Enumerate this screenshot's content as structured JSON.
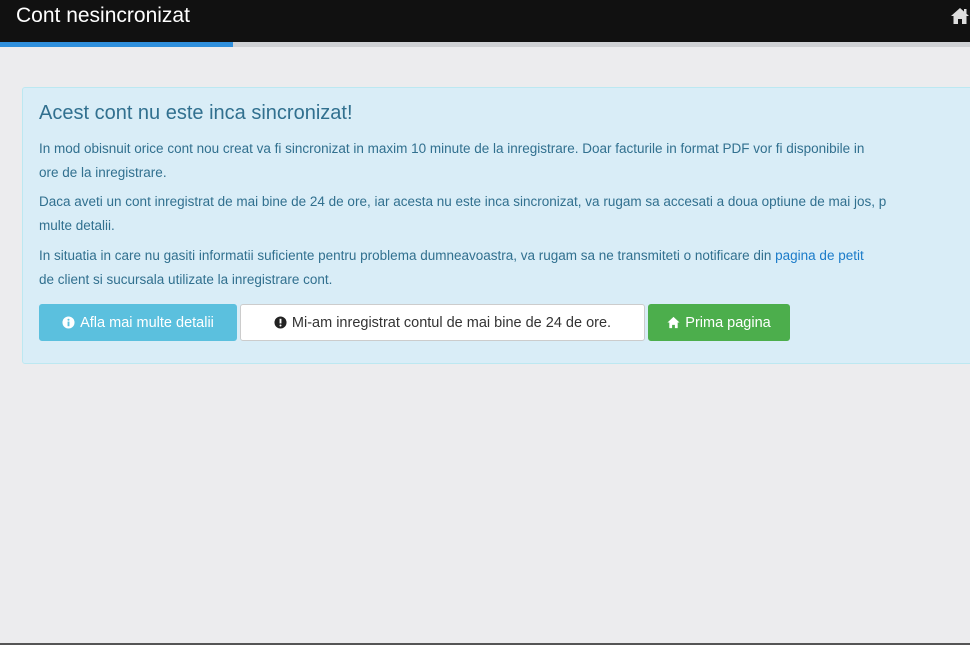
{
  "header": {
    "title": "Cont nesincronizat",
    "home_icon": "home-icon",
    "progress_percent": 24
  },
  "alert": {
    "heading": "Acest cont nu este inca sincronizat!",
    "p1_line1": "In mod obisnuit orice cont nou creat va fi sincronizat in maxim 10 minute de la inregistrare. Doar facturile in format PDF vor fi disponibile in",
    "p1_line2": "ore de la inregistrare.",
    "p2_line1": "Daca aveti un cont inregistrat de mai bine de 24 de ore, iar acesta nu este inca sincronizat, va rugam sa accesati a doua optiune de mai jos, p",
    "p2_line2": "multe detalii.",
    "p3_line1_text": "In situatia in care nu gasiti informatii suficiente pentru problema dumneavoastra, va rugam sa ne transmiteti o notificare din ",
    "p3_link": "pagina de petit",
    "p3_line2": "de client si sucursala utilizate la inregistrare cont."
  },
  "buttons": {
    "details": "Afla mai multe detalii",
    "registered": "Mi-am inregistrat contul de mai bine de 24 de ore.",
    "home": "Prima pagina"
  },
  "colors": {
    "topbar": "#111111",
    "progress": "#2f8fdc",
    "alert_bg": "#d9edf7",
    "info": "#5bc0de",
    "success": "#4cae4c"
  }
}
